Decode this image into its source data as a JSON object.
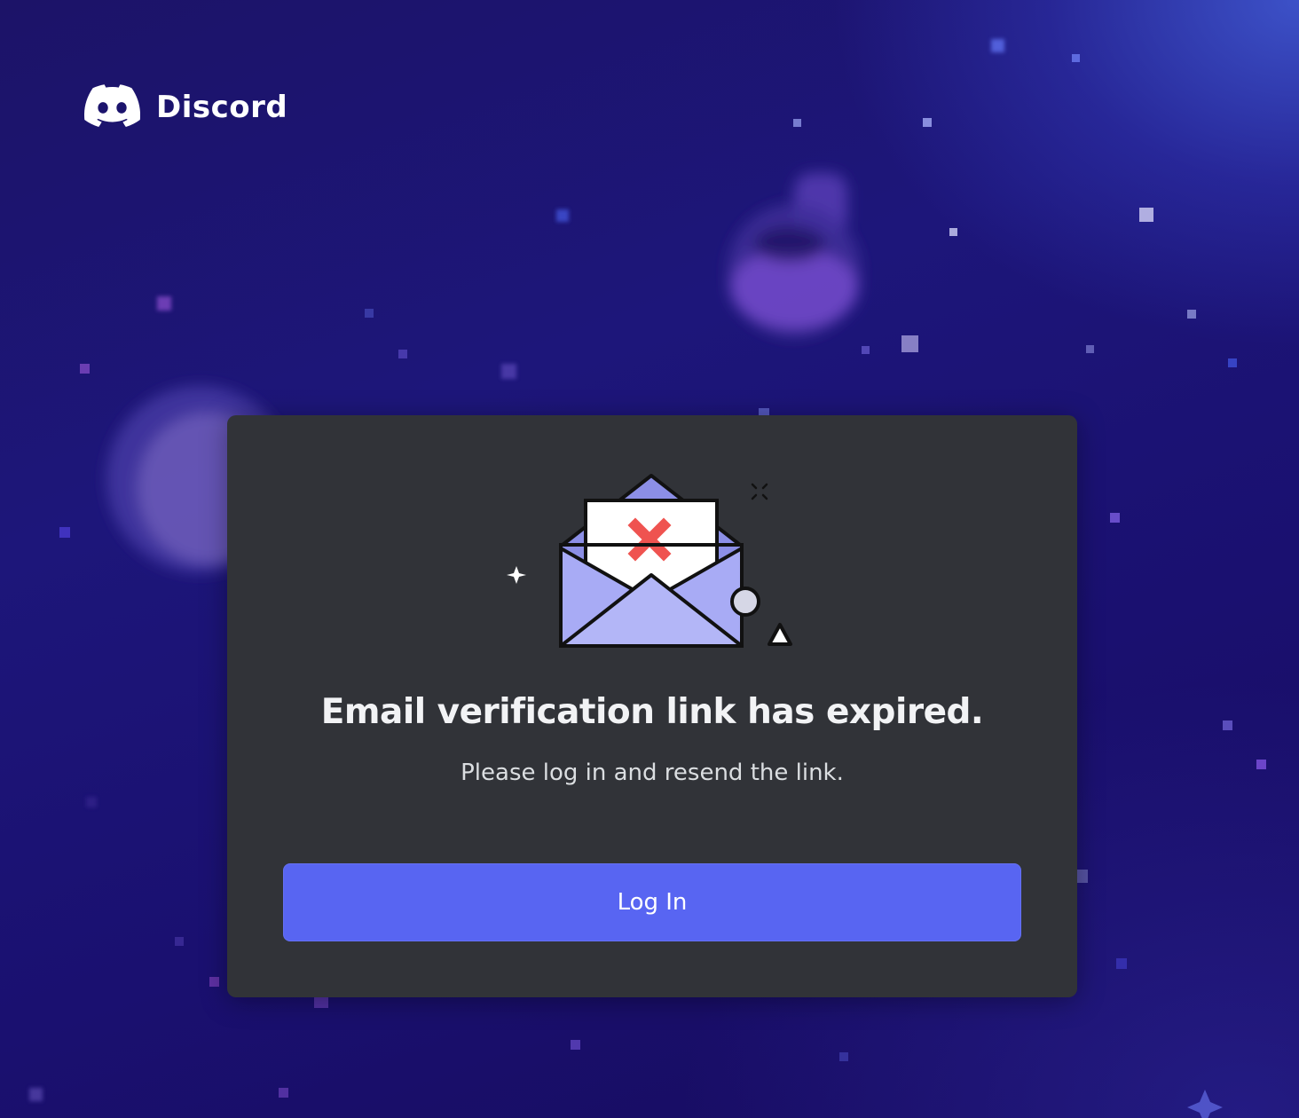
{
  "brand": {
    "name": "Discord",
    "icon": "discord-logo-icon"
  },
  "card": {
    "illustration_icon": "expired-email-envelope-icon",
    "title": "Email verification link has expired.",
    "subtitle": "Please log in and resend the link.",
    "login_button_label": "Log In"
  },
  "colors": {
    "background": "#1c1368",
    "card_background": "#313338",
    "button": "#5865f2",
    "envelope": "#a8abf5",
    "error_mark": "#ef5350"
  }
}
